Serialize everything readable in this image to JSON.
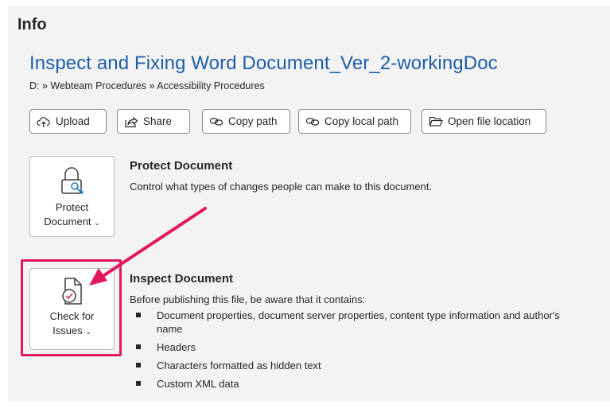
{
  "header": {
    "title": "Info"
  },
  "document": {
    "title": "Inspect and Fixing Word Document_Ver_2-workingDoc",
    "path": "D: » Webteam Procedures » Accessibility Procedures"
  },
  "toolbar": {
    "upload": "Upload",
    "share": "Share",
    "copy_path": "Copy path",
    "copy_local_path": "Copy local path",
    "open_location": "Open file location"
  },
  "protect": {
    "button_line1": "Protect",
    "button_line2": "Document",
    "title": "Protect Document",
    "description": "Control what types of changes people can make to this document."
  },
  "inspect": {
    "button_line1": "Check for",
    "button_line2": "Issues",
    "title": "Inspect Document",
    "description": "Before publishing this file, be aware that it contains:",
    "items": [
      "Document properties, document server properties, content type information and author's name",
      "Headers",
      "Characters formatted as hidden text",
      "Custom XML data"
    ]
  },
  "icons": {
    "upload": "upload-cloud-icon",
    "share": "share-icon",
    "copy_path": "link-icon",
    "copy_local_path": "link-icon",
    "open_location": "folder-icon",
    "protect": "lock-key-icon",
    "inspect": "document-check-icon",
    "dropdown": "chevron-down-icon"
  },
  "colors": {
    "title": "#1f5ea8",
    "highlight": "#e3175e",
    "panel": "#f3f3f3"
  }
}
